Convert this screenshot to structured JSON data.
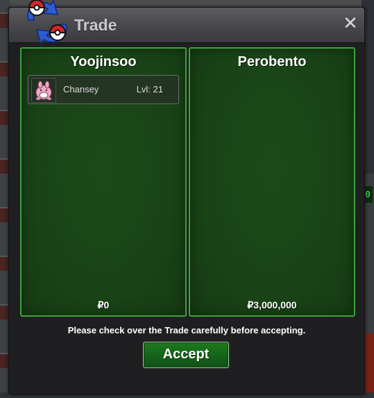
{
  "window": {
    "title": "Trade",
    "close_symbol": "✕"
  },
  "left_panel": {
    "trainer": "Yoojinsoo",
    "items": [
      {
        "name": "Chansey",
        "level": "Lvl: 21",
        "icon": "chansey-sprite-icon"
      }
    ],
    "money": "₽0"
  },
  "right_panel": {
    "trainer": "Perobento",
    "items": [],
    "money": "₽3,000,000"
  },
  "notice": "Please check over the Trade carefully before accepting.",
  "accept_label": "Accept",
  "colors": {
    "panel_border": "#3da33a",
    "panel_fill": "#1a4417",
    "accept_button": "#1a6e1c"
  }
}
